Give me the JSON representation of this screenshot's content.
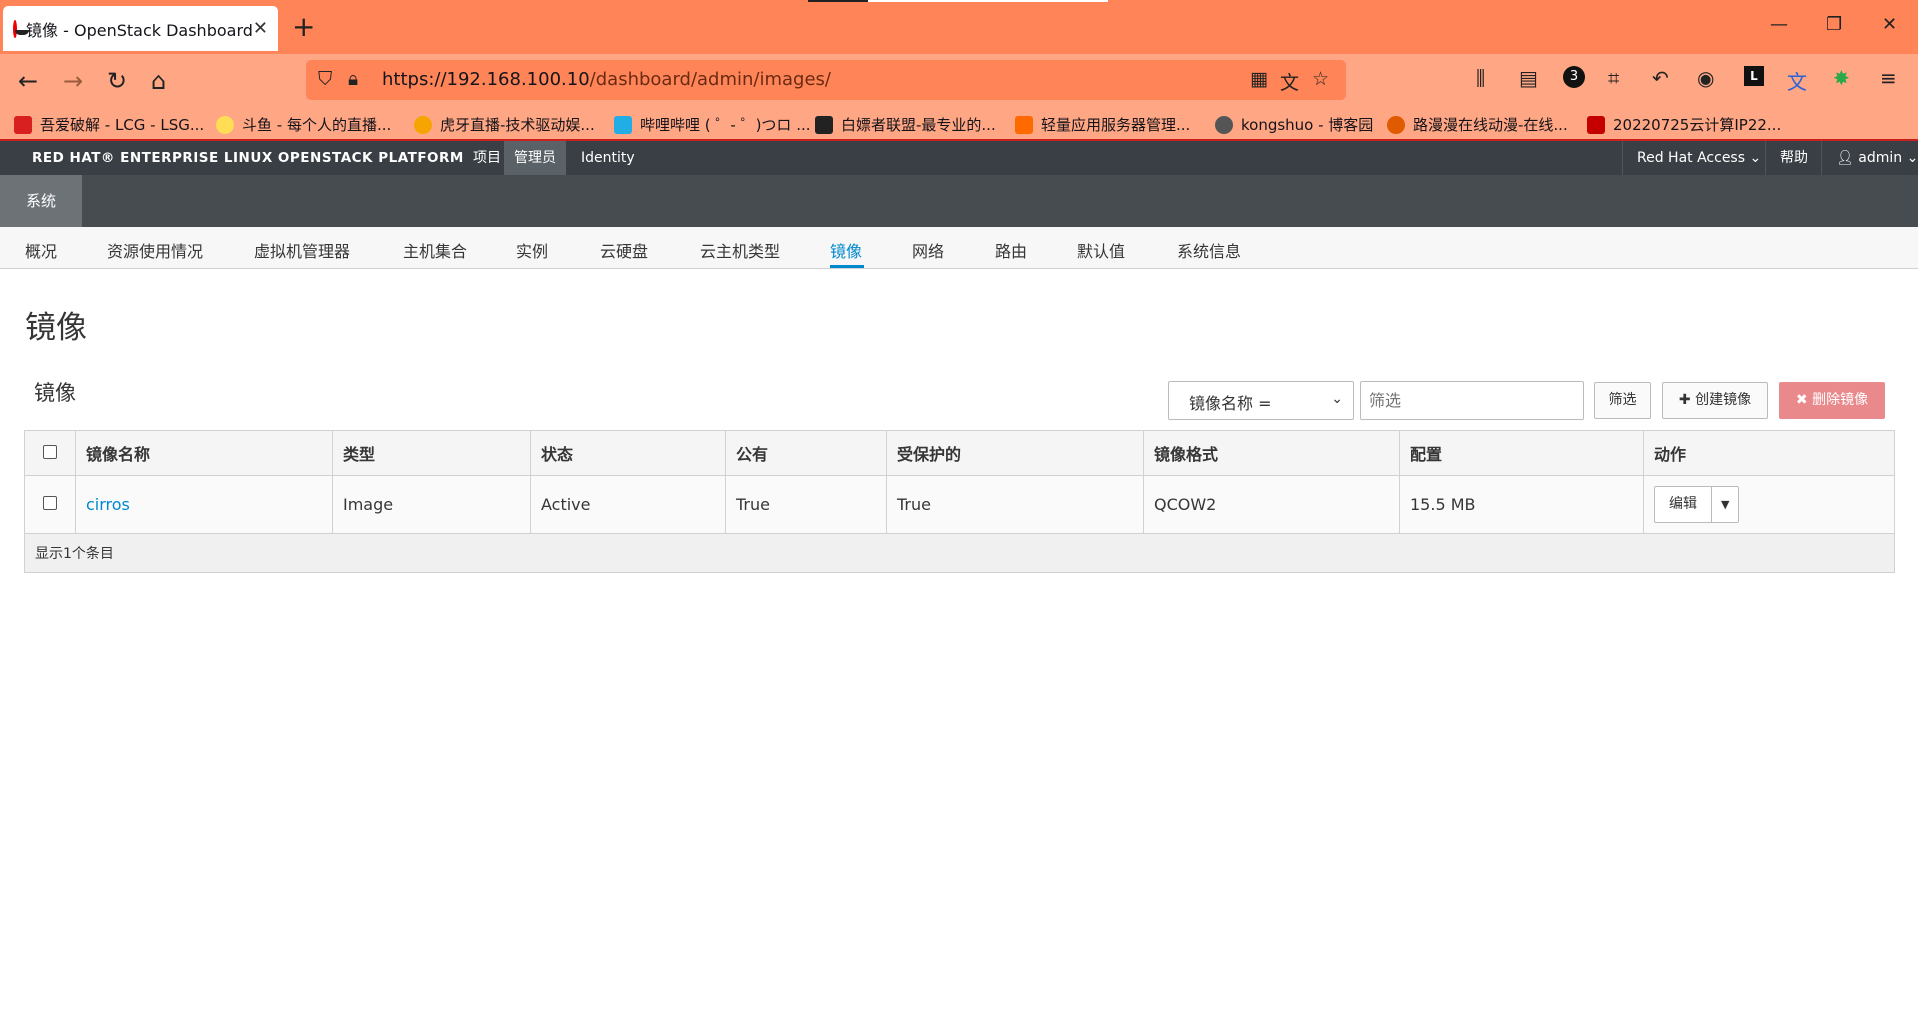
{
  "browser": {
    "tab_title": "镜像 - OpenStack Dashboard",
    "url_host": "https://192.168.100.10",
    "url_path": "/dashboard/admin/images/",
    "bookmarks": [
      "吾爱破解 - LCG - LSG...",
      "斗鱼 - 每个人的直播...",
      "虎牙直播-技术驱动娱...",
      "哔哩哔哩 ( ゜- ゜)つロ ...",
      "白嫖者联盟-最专业的...",
      "轻量应用服务器管理...",
      "kongshuo - 博客园",
      "路漫漫在线动漫-在线...",
      "20220725云计算IP22..."
    ],
    "notification_count": "3"
  },
  "header": {
    "brand": "RED HAT® ENTERPRISE LINUX OPENSTACK PLATFORM",
    "nav": [
      "项目",
      "管理员",
      "Identity"
    ],
    "active_nav": "管理员",
    "red_hat_access": "Red Hat Access",
    "help": "帮助",
    "user": "admin"
  },
  "section_tab": "系统",
  "subnav": [
    "概况",
    "资源使用情况",
    "虚拟机管理器",
    "主机集合",
    "实例",
    "云硬盘",
    "云主机类型",
    "镜像",
    "网络",
    "路由",
    "默认值",
    "系统信息"
  ],
  "active_subnav": "镜像",
  "page_title": "镜像",
  "section_title": "镜像",
  "filter": {
    "selected": "镜像名称 =",
    "placeholder": "筛选",
    "filter_button": "筛选",
    "create_button": "创建镜像",
    "delete_button": "删除镜像"
  },
  "table": {
    "columns": [
      "镜像名称",
      "类型",
      "状态",
      "公有",
      "受保护的",
      "镜像格式",
      "配置",
      "动作"
    ],
    "rows": [
      {
        "name": "cirros",
        "type": "Image",
        "status": "Active",
        "public": "True",
        "protected": "True",
        "format": "QCOW2",
        "size": "15.5 MB",
        "action": "编辑"
      }
    ],
    "footer": "显示1个条目"
  }
}
